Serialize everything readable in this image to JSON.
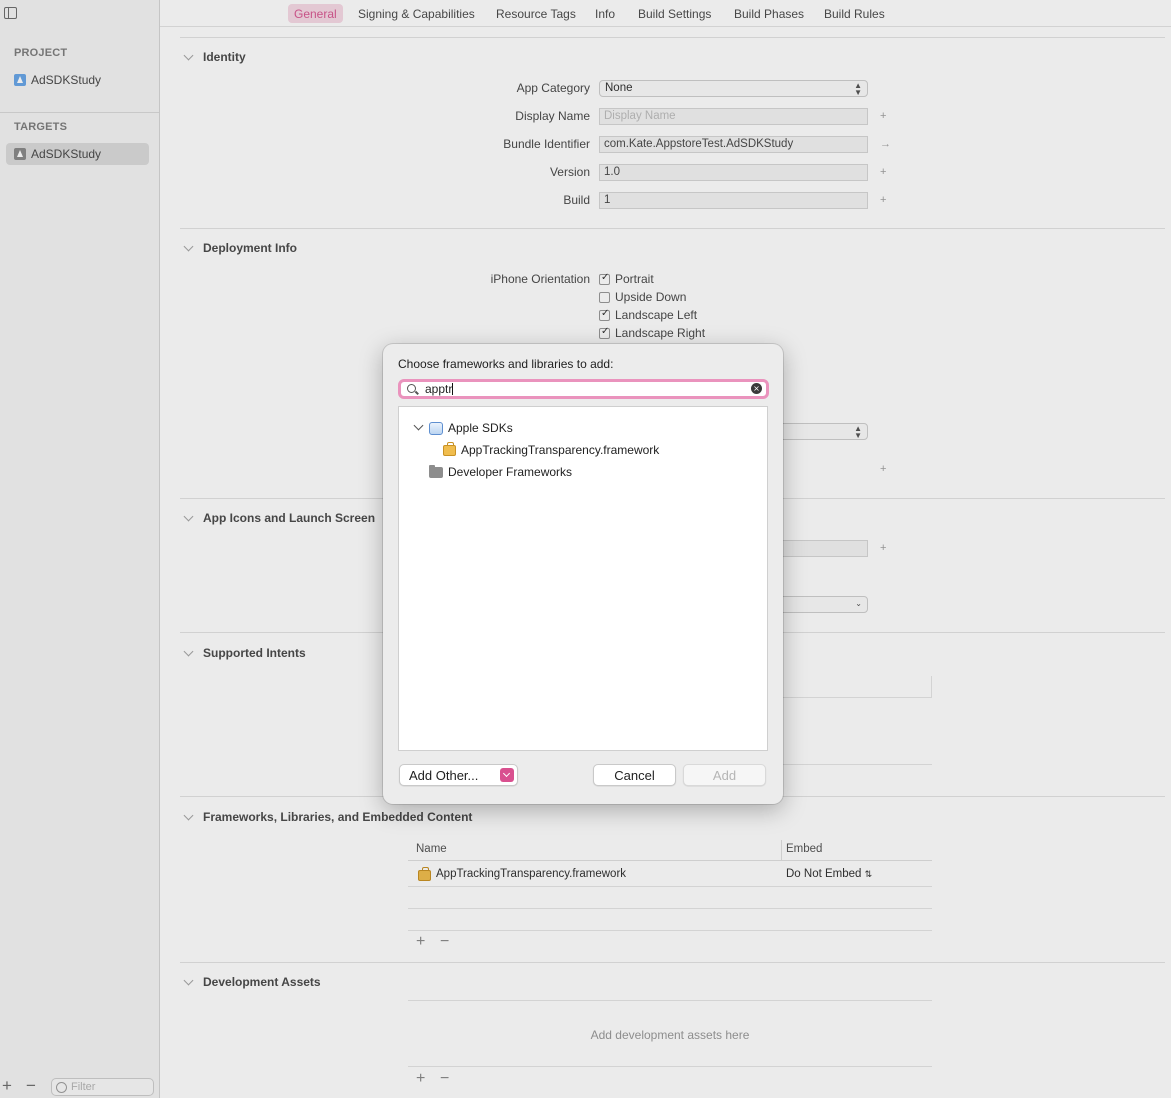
{
  "tabs": [
    "General",
    "Signing & Capabilities",
    "Resource Tags",
    "Info",
    "Build Settings",
    "Build Phases",
    "Build Rules"
  ],
  "active_tab": "General",
  "sidebar": {
    "project_heading": "PROJECT",
    "project_item": "AdSDKStudy",
    "targets_heading": "TARGETS",
    "target_item": "AdSDKStudy",
    "filter_placeholder": "Filter"
  },
  "identity": {
    "title": "Identity",
    "app_category_label": "App Category",
    "app_category_value": "None",
    "display_name_label": "Display Name",
    "display_name_placeholder": "Display Name",
    "bundle_id_label": "Bundle Identifier",
    "bundle_id_value": "com.Kate.AppstoreTest.AdSDKStudy",
    "version_label": "Version",
    "version_value": "1.0",
    "build_label": "Build",
    "build_value": "1"
  },
  "deployment": {
    "title": "Deployment Info",
    "orientation_label": "iPhone Orientation",
    "orientations": [
      {
        "label": "Portrait",
        "checked": true
      },
      {
        "label": "Upside Down",
        "checked": false
      },
      {
        "label": "Landscape Left",
        "checked": true
      },
      {
        "label": "Landscape Right",
        "checked": true
      }
    ]
  },
  "app_icons": {
    "title": "App Icons and Launch Screen"
  },
  "intents": {
    "title": "Supported Intents"
  },
  "frameworks": {
    "title": "Frameworks, Libraries, and Embedded Content",
    "col_name": "Name",
    "col_embed": "Embed",
    "rows": [
      {
        "name": "AppTrackingTransparency.framework",
        "embed": "Do Not Embed"
      }
    ]
  },
  "dev_assets": {
    "title": "Development Assets",
    "empty_text": "Add development assets here"
  },
  "dialog": {
    "title": "Choose frameworks and libraries to add:",
    "search_value": "apptr",
    "tree": {
      "group1": "Apple SDKs",
      "group1_child": "AppTrackingTransparency.framework",
      "group2": "Developer Frameworks"
    },
    "add_other_label": "Add Other...",
    "cancel_label": "Cancel",
    "add_label": "Add"
  },
  "colors": {
    "accent": "#d95a93",
    "search_focus_ring": "#ea93bd"
  }
}
